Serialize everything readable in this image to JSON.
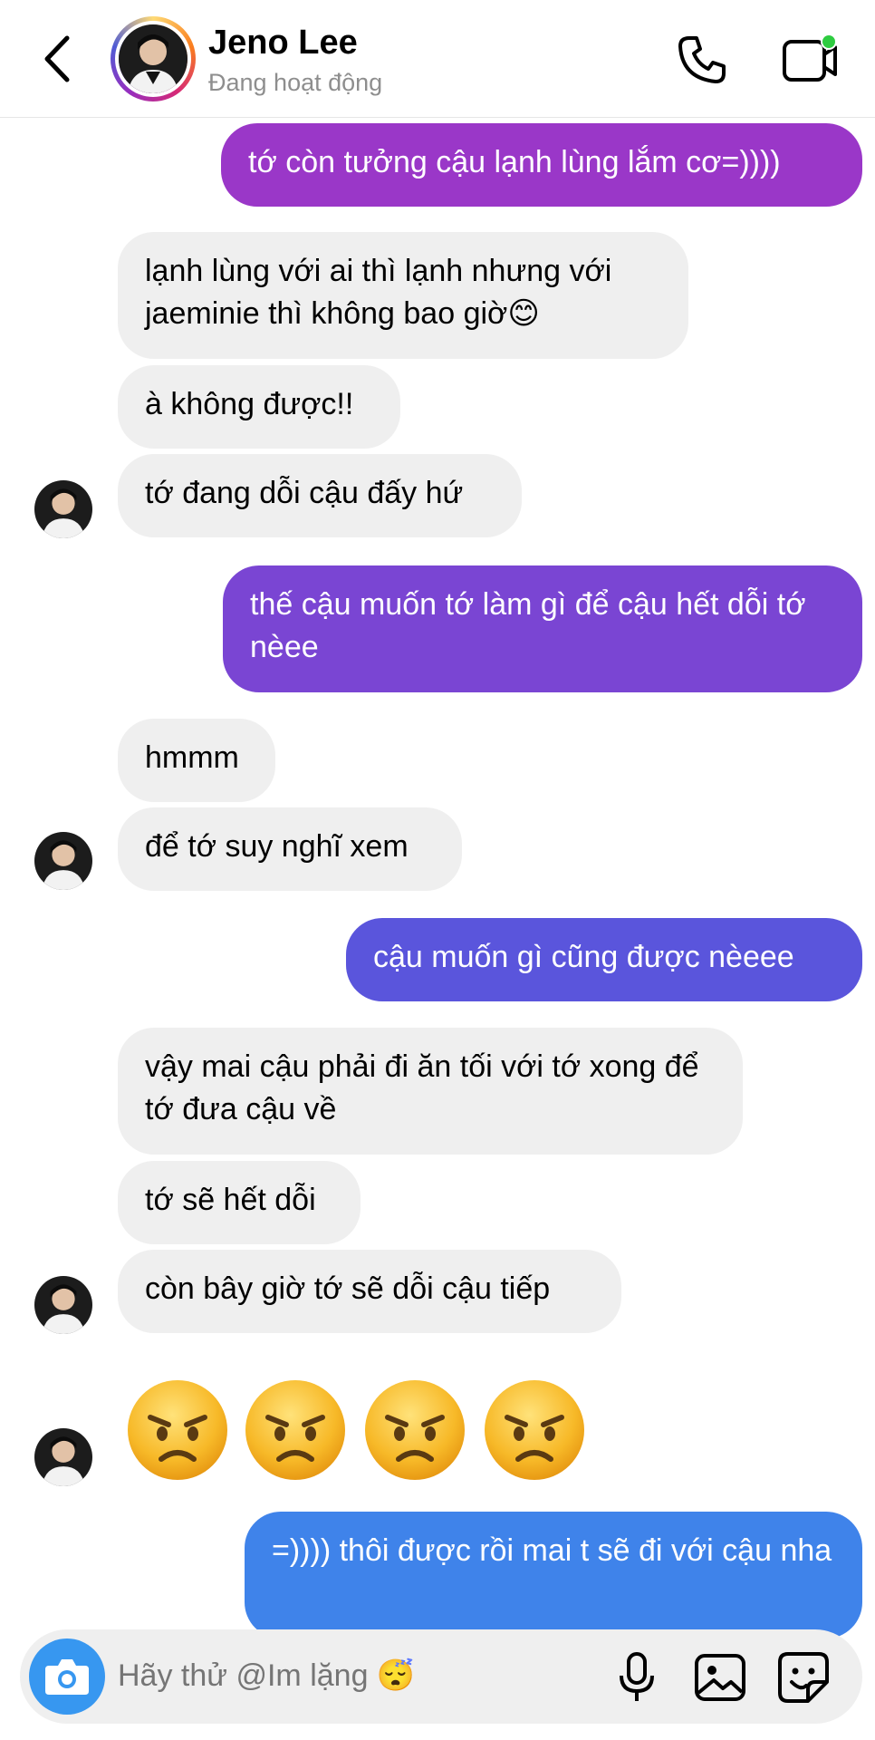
{
  "header": {
    "name": "Jeno Lee",
    "status": "Đang hoạt động",
    "online_color": "#2ecc40"
  },
  "messages": [
    {
      "side": "out",
      "text": "tớ còn tưởng cậu lạnh lùng lắm cơ=))))",
      "color": "#9a37c8"
    },
    {
      "side": "in",
      "text": "lạnh lùng với ai thì lạnh nhưng với jaeminie thì không bao giờ😊"
    },
    {
      "side": "in",
      "text": "à không được!!"
    },
    {
      "side": "in",
      "text": "tớ đang dỗi cậu đấy hứ"
    },
    {
      "side": "out",
      "text": "thế cậu muốn tớ làm gì để cậu hết dỗi tớ nèee",
      "color": "#7a45d3"
    },
    {
      "side": "in",
      "text": "hmmm"
    },
    {
      "side": "in",
      "text": "để tớ suy nghĩ xem"
    },
    {
      "side": "out",
      "text": "cậu muốn gì cũng được nèeee",
      "color": "#5a55dc"
    },
    {
      "side": "in",
      "text": "vậy mai cậu phải đi ăn tối với tớ xong để tớ đưa cậu về"
    },
    {
      "side": "in",
      "text": "tớ sẽ hết dỗi"
    },
    {
      "side": "in",
      "text": "còn bây giờ tớ sẽ dỗi cậu tiếp"
    },
    {
      "side": "out",
      "text": "=)))) thôi được rồi mai t sẽ đi với cậu nha",
      "color": "#3f83ea"
    }
  ],
  "emoji_row": [
    "angry-face",
    "angry-face",
    "angry-face",
    "angry-face"
  ],
  "composer": {
    "placeholder": "Hãy thử @Im lặng 😴"
  },
  "icons": {
    "back": "chevron-left-icon",
    "call": "phone-icon",
    "video": "video-camera-icon",
    "camera": "camera-icon",
    "mic": "microphone-icon",
    "gallery": "image-icon",
    "sticker": "sticker-icon"
  }
}
